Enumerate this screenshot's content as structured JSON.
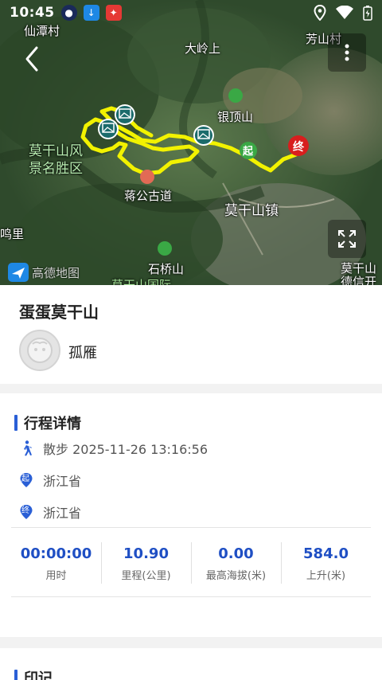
{
  "status_bar": {
    "time": "10:45"
  },
  "map": {
    "labels": {
      "xiantan": "仙潭村",
      "fangshan": "芳山村",
      "daling": "大岭上",
      "yinding": "银顶山",
      "scenic": "莫干山风\n景名胜区",
      "jianggong": "蒋公古道",
      "town": "莫干山镇",
      "shiqiao": "石桥山",
      "left_edge": "鸣里",
      "intl": "莫干山国际",
      "right_bottom_1": "莫干山",
      "right_bottom_2": "德信开"
    },
    "start_marker": "起",
    "end_marker": "终",
    "logo_text": "高德地图",
    "route_color": "#f2f200"
  },
  "route_card": {
    "title": "蛋蛋莫干山",
    "user_name": "孤雁"
  },
  "details": {
    "heading": "行程详情",
    "activity": "散步 2025-11-26 13:16:56",
    "start_place": "浙江省",
    "end_place": "浙江省",
    "start_badge": "起",
    "end_badge": "终",
    "stats": [
      {
        "value": "00:00:00",
        "label": "用时"
      },
      {
        "value": "10.90",
        "label": "里程(公里)"
      },
      {
        "value": "0.00",
        "label": "最高海拔(米)"
      },
      {
        "value": "584.0",
        "label": "上升(米)"
      }
    ]
  },
  "notes": {
    "heading": "印记"
  },
  "colors": {
    "accent": "#2a5fd6",
    "stat_value": "#1f4fc4",
    "end_marker": "#d81e1e",
    "start_marker": "#3aa845"
  }
}
